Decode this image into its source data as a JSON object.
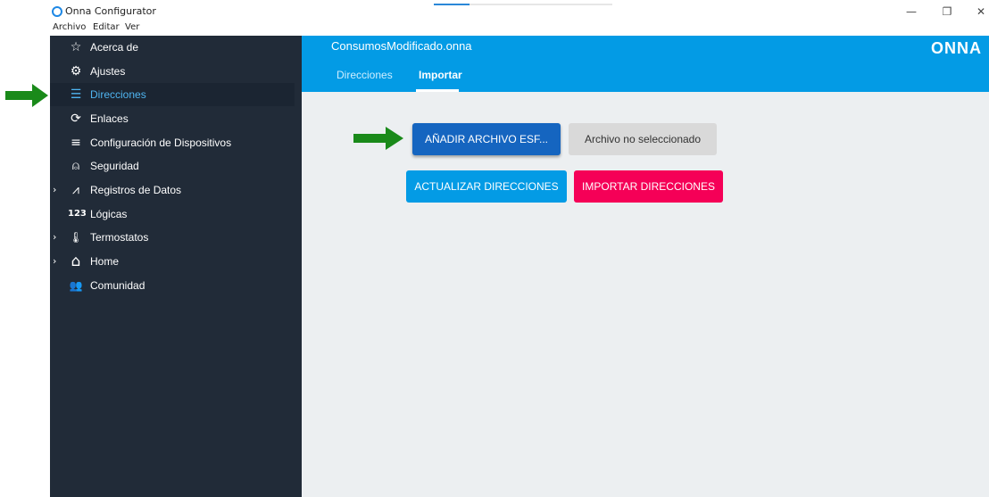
{
  "window": {
    "title": "Onna Configurator",
    "progress": 0.2,
    "minimize_glyph": "—",
    "restore_glyph": "❐",
    "close_glyph": "✕"
  },
  "menubar": {
    "items": [
      "Archivo",
      "Editar",
      "Ver"
    ]
  },
  "sidebar": {
    "items": [
      {
        "label": "Acerca de",
        "icon": "star-outline-icon",
        "glyph": "☆",
        "expandable": false,
        "active": false
      },
      {
        "label": "Ajustes",
        "icon": "gear-icon",
        "glyph": "⚙",
        "expandable": false,
        "active": false
      },
      {
        "label": "Direcciones",
        "icon": "list-icon",
        "glyph": "☰",
        "expandable": false,
        "active": true
      },
      {
        "label": "Enlaces",
        "icon": "refresh-icon",
        "glyph": "⟳",
        "expandable": false,
        "active": false
      },
      {
        "label": "Configuración de Dispositivos",
        "icon": "edit-list-icon",
        "glyph": "≡",
        "expandable": false,
        "active": false
      },
      {
        "label": "Seguridad",
        "icon": "alarm-light-icon",
        "glyph": "⍝",
        "expandable": false,
        "active": false
      },
      {
        "label": "Registros de Datos",
        "icon": "chart-icon",
        "glyph": "⩘",
        "expandable": true,
        "active": false
      },
      {
        "label": "Lógicas",
        "icon": "numeric-icon",
        "glyph": "123",
        "expandable": false,
        "active": false
      },
      {
        "label": "Termostatos",
        "icon": "thermometer-icon",
        "glyph": "🌡",
        "expandable": true,
        "active": false
      },
      {
        "label": "Home",
        "icon": "home-icon",
        "glyph": "⌂",
        "expandable": true,
        "active": false
      },
      {
        "label": "Comunidad",
        "icon": "people-icon",
        "glyph": "👥",
        "expandable": false,
        "active": false
      }
    ],
    "chevron_glyph": "›"
  },
  "header": {
    "file_name": "ConsumosModificado.onna",
    "brand": "ONNA",
    "tabs": [
      {
        "label": "Direcciones",
        "active": false
      },
      {
        "label": "Importar",
        "active": true
      }
    ]
  },
  "main": {
    "add_file_label": "AÑADIR ARCHIVO ESF...",
    "file_status": "Archivo no seleccionado",
    "update_label": "ACTUALIZAR DIRECCIONES",
    "import_label": "IMPORTAR DIRECCIONES"
  },
  "colors": {
    "sidebar_bg": "#212b38",
    "accent_blue": "#039be5",
    "primary_button": "#1565c0",
    "import_button": "#f50057",
    "active_nav": "#4fb4f0",
    "annotation_arrow": "#1a8a1a"
  }
}
